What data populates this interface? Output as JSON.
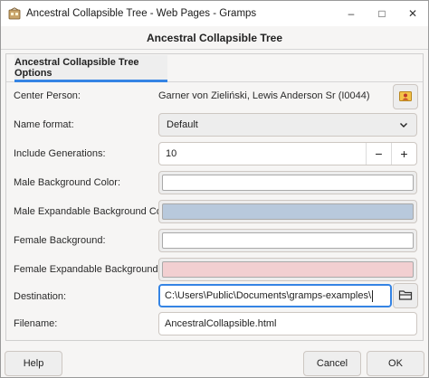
{
  "window": {
    "title": "Ancestral Collapsible Tree - Web Pages - Gramps",
    "controls": [
      "–",
      "□",
      "✕"
    ]
  },
  "header": {
    "title": "Ancestral Collapsible Tree"
  },
  "tabs": [
    {
      "label": "Ancestral Collapsible Tree Options",
      "active": true
    }
  ],
  "form": {
    "center_person": {
      "label": "Center Person:",
      "value": "Garner von Zieliński, Lewis Anderson Sr (I0044)"
    },
    "name_format": {
      "label": "Name format:",
      "value": "Default"
    },
    "include_generations": {
      "label": "Include Generations:",
      "value": "10",
      "decrement": "−",
      "increment": "+"
    },
    "male_bg": {
      "label": "Male Background Color:",
      "color": "#ffffff"
    },
    "male_exp_bg": {
      "label": "Male Expandable Background Color:",
      "color": "#b8c9dc"
    },
    "female_bg": {
      "label": "Female Background:",
      "color": "#ffffff"
    },
    "female_exp_bg": {
      "label": "Female Expandable Background:",
      "color": "#f2cfd1"
    },
    "destination": {
      "label": "Destination:",
      "value": "C:\\Users\\Public\\Documents\\gramps-examples\\"
    },
    "filename": {
      "label": "Filename:",
      "value": "AncestralCollapsible.html"
    }
  },
  "buttons": {
    "help": "Help",
    "cancel": "Cancel",
    "ok": "OK"
  },
  "icons": {
    "app": "gramps-icon",
    "select_person": "person-select-icon",
    "folder": "folder-open-icon",
    "dropdown": "chevron-down-icon"
  },
  "colors": {
    "accent": "#3584e4"
  }
}
